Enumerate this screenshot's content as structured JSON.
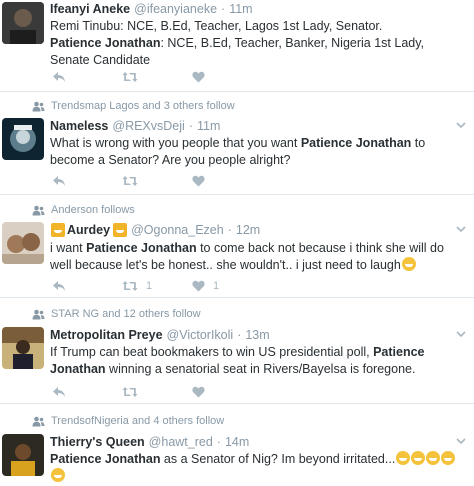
{
  "tweets": [
    {
      "social": "",
      "name": "Ifeanyi Aneke",
      "handle": "@ifeanyianeke",
      "dot": "·",
      "time": "11m",
      "lines": [
        {
          "pre": "Remi Tinubu: NCE, B.Ed, Teacher, Lagos 1st Lady, Senator.",
          "bold": "",
          "post": ""
        },
        {
          "pre": "",
          "bold": "Patience Jonathan",
          "post": ": NCE, B.Ed, Teacher, Banker, Nigeria 1st Lady, Senate Candidate"
        }
      ],
      "retweets": "",
      "likes": ""
    },
    {
      "social": "Trendsmap Lagos and 3 others follow",
      "name": "Nameless",
      "handle": "@REXvsDeji",
      "dot": "·",
      "time": "11m",
      "lines": [
        {
          "pre": "What is wrong with you people  that you want ",
          "bold": "Patience Jonathan",
          "post": " to become a Senator?  Are you people alright?"
        }
      ],
      "retweets": "",
      "likes": ""
    },
    {
      "social": "Anderson follows",
      "name": "Aurdey",
      "handle": "@Ogonna_Ezeh",
      "dot": "·",
      "time": "12m",
      "lines": [
        {
          "pre": "i want ",
          "bold": "Patience Jonathan",
          "post": " to come back not because i think she will  do well because let's be honest.. she wouldn't.. i just need to laugh"
        }
      ],
      "retweets": "1",
      "likes": "1"
    },
    {
      "social": "STAR NG and 12 others follow",
      "name": "Metropolitan Preye",
      "handle": "@VictorIkoli",
      "dot": "·",
      "time": "13m",
      "lines": [
        {
          "pre": "If Trump can beat bookmakers to win US presidential poll, ",
          "bold": "Patience Jonathan",
          "post": " winning a senatorial seat in Rivers/Bayelsa is foregone."
        }
      ],
      "retweets": "",
      "likes": ""
    },
    {
      "social": "TrendsofNigeria and 4 others follow",
      "name": "Thierry's Queen",
      "handle": "@hawt_red",
      "dot": "·",
      "time": "14m",
      "lines": [
        {
          "pre": "",
          "bold": "Patience Jonathan",
          "post": " as a Senator of Nig? Im beyond irritated..."
        }
      ],
      "retweets": "",
      "likes": ""
    }
  ],
  "icons": {
    "reply": "reply-icon",
    "retweet": "retweet-icon",
    "like": "heart-icon",
    "caret": "chevron-down-icon",
    "follow": "person-icon"
  },
  "colors": {
    "text": "#292f33",
    "muted": "#8899a6",
    "action": "#aab8c2",
    "divider": "#e1e8ed"
  }
}
